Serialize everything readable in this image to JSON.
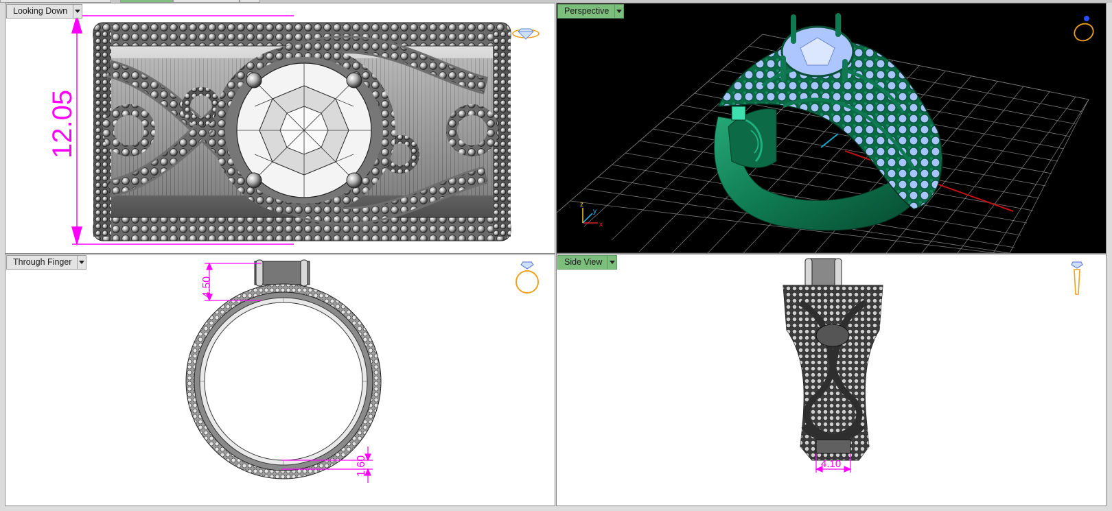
{
  "viewports": {
    "top_left": {
      "label": "Looking Down",
      "dimension": "12.05",
      "active": false
    },
    "top_right": {
      "label": "Perspective",
      "active": true
    },
    "bottom_left": {
      "label": "Through Finger",
      "dimension_top": "4.50",
      "dimension_bottom": "1.60",
      "active": false
    },
    "bottom_right": {
      "label": "Side View",
      "dimension": "4.10",
      "active": true
    }
  },
  "icons": {
    "view_dropdown": "chevron-down-icon",
    "looking_down_nav": "ring-top-nav-icon",
    "perspective_nav": "ring-perspective-nav-icon",
    "through_finger_nav": "ring-front-nav-icon",
    "side_view_nav": "ring-side-nav-icon",
    "axis_gizmo": "xyz-axis-icon"
  },
  "colors": {
    "dimension": "#ff00ff",
    "ring_metal_render": "#0f7a52",
    "gem_render": "#a9c4ff",
    "grid": "#8c8c8c",
    "nav_icon": "#f0a020",
    "label_active": "#7cbf7c",
    "label_inactive": "#e3e3e3"
  },
  "axis_labels": {
    "x": "x",
    "y": "y",
    "z": "z"
  }
}
